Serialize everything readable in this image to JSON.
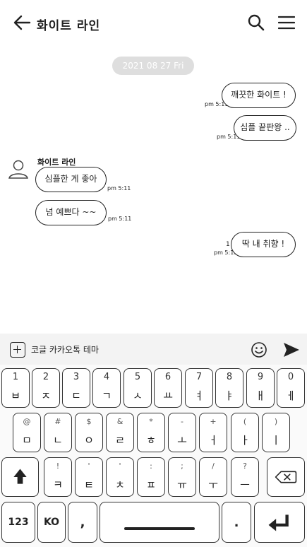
{
  "header": {
    "title": "화이트 라인",
    "back_icon": "arrow-left-icon",
    "search_icon": "search-icon",
    "menu_icon": "hamburger-menu-icon"
  },
  "chat": {
    "date": "2021 08 27 Fri",
    "sender_name": "화이트 라인",
    "messages": [
      {
        "side": "right",
        "text": "깨끗한 화이트 !",
        "time": "pm 5:11"
      },
      {
        "side": "right",
        "text": "심플 끝판왕 ..",
        "time": "pm 5:11"
      },
      {
        "side": "left",
        "text": "심플한 게 좋아",
        "time": "pm 5:11"
      },
      {
        "side": "left",
        "text": "넘 예쁘다 ~~",
        "time": "pm 5:11"
      },
      {
        "side": "right",
        "text": "딱 내 취향 !",
        "time": "pm 5:11",
        "unread": "1"
      }
    ]
  },
  "input_bar": {
    "value": "코글 카카오톡 테마",
    "plus_icon": "plus-square-icon",
    "emoji_icon": "smiley-icon",
    "send_icon": "send-arrow-icon"
  },
  "keyboard": {
    "row1": [
      {
        "top": "1",
        "char": "ㅂ"
      },
      {
        "top": "2",
        "char": "ㅈ"
      },
      {
        "top": "3",
        "char": "ㄷ"
      },
      {
        "top": "4",
        "char": "ㄱ"
      },
      {
        "top": "5",
        "char": "ㅅ"
      },
      {
        "top": "6",
        "char": "ㅛ"
      },
      {
        "top": "7",
        "char": "ㅕ"
      },
      {
        "top": "8",
        "char": "ㅑ"
      },
      {
        "top": "9",
        "char": "ㅐ"
      },
      {
        "top": "0",
        "char": "ㅔ"
      }
    ],
    "row2": [
      {
        "top": "@",
        "char": "ㅁ"
      },
      {
        "top": "#",
        "char": "ㄴ"
      },
      {
        "top": "$",
        "char": "ㅇ"
      },
      {
        "top": "&",
        "char": "ㄹ"
      },
      {
        "top": "*",
        "char": "ㅎ"
      },
      {
        "top": "-",
        "char": "ㅗ"
      },
      {
        "top": "+",
        "char": "ㅓ"
      },
      {
        "top": "(",
        "char": "ㅏ"
      },
      {
        "top": ")",
        "char": "ㅣ"
      }
    ],
    "row3": [
      {
        "top": "!",
        "char": "ㅋ"
      },
      {
        "top": "'",
        "char": "ㅌ"
      },
      {
        "top": "'",
        "char": "ㅊ"
      },
      {
        "top": ":",
        "char": "ㅍ"
      },
      {
        "top": ";",
        "char": "ㅠ"
      },
      {
        "top": "/",
        "char": "ㅜ"
      },
      {
        "top": "?",
        "char": "ㅡ"
      }
    ],
    "shift_icon": "shift-arrow-icon",
    "backspace_icon": "backspace-icon",
    "key_123": "123",
    "key_lang": "KO",
    "key_comma": ",",
    "key_period": ".",
    "enter_icon": "enter-return-icon"
  }
}
